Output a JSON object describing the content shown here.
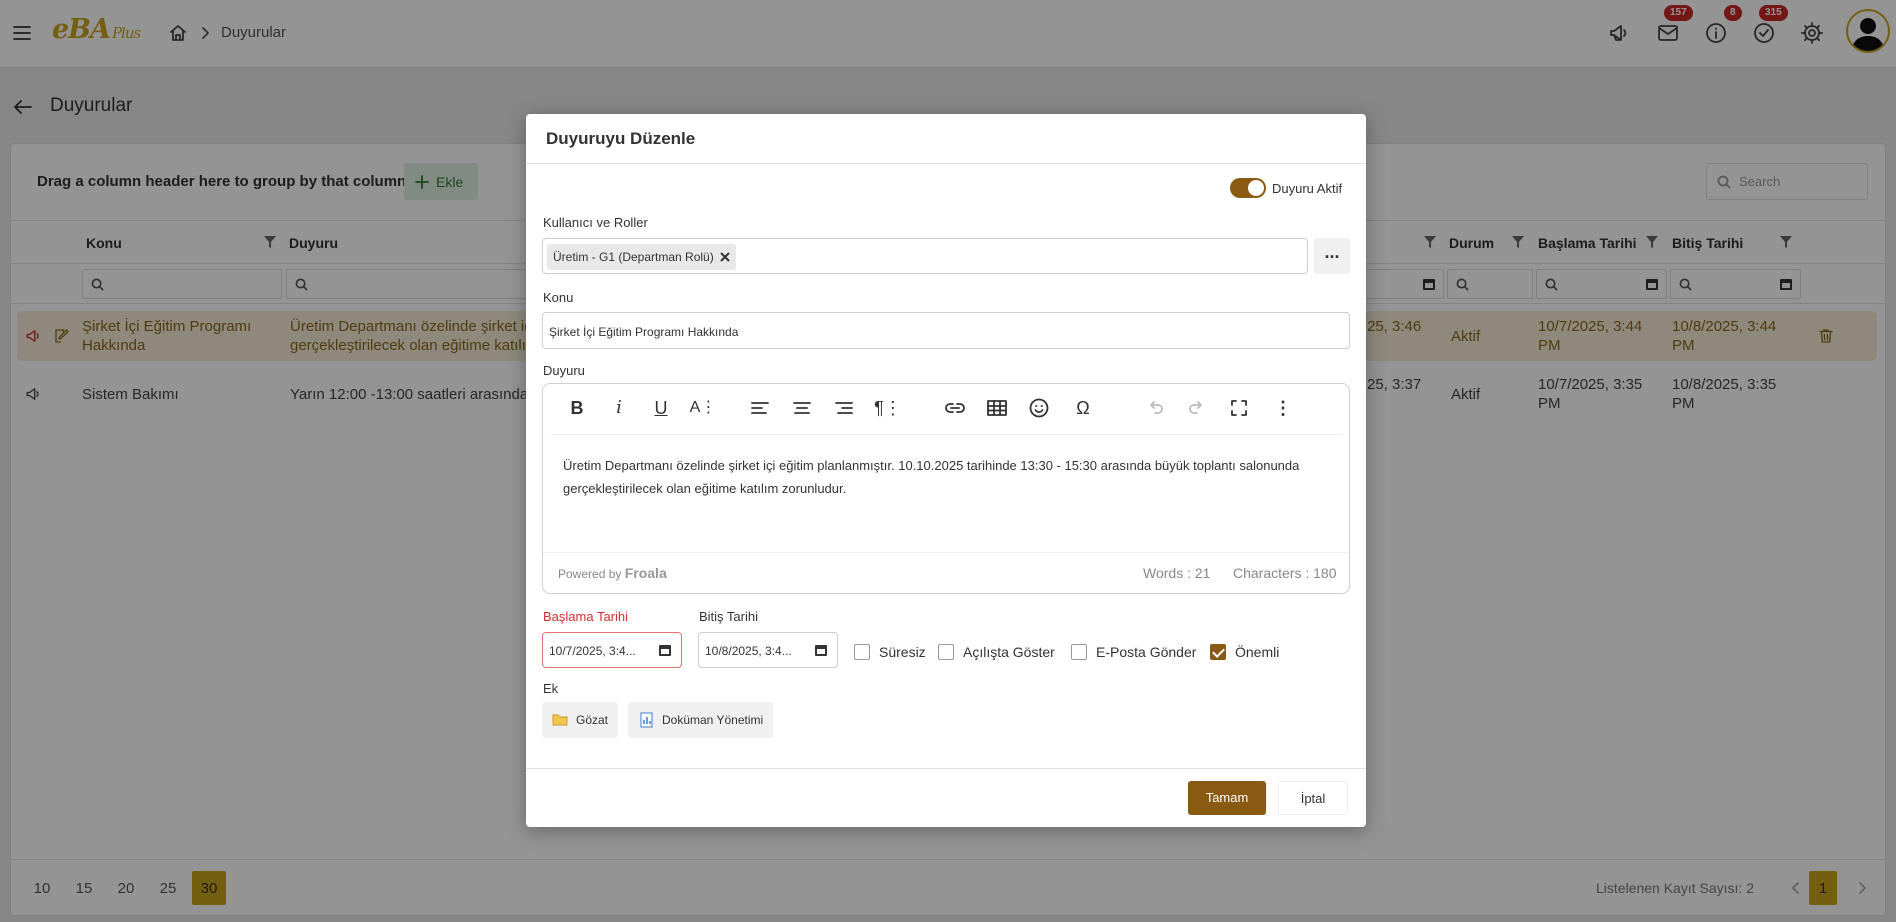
{
  "topbar": {
    "logo_main": "eBA",
    "logo_sub": "Plus",
    "breadcrumb": "Duyurular",
    "badges": {
      "mail": "157",
      "info": "8",
      "tasks": "315"
    }
  },
  "page": {
    "title": "Duyurular"
  },
  "grid": {
    "group_hint": "Drag a column header here to group by that column",
    "add_label": "Ekle",
    "search_placeholder": "Search",
    "columns": {
      "konu": "Konu",
      "duyuru": "Duyuru",
      "durum": "Durum",
      "baslama": "Başlama Tarihi",
      "bitis": "Bitiş Tarihi"
    },
    "rows": [
      {
        "konu": "Şirket İçi Eğitim Programı Hakkında",
        "duyuru": "Üretim Departmanı özelinde şirket iç gerçekleştirilecek olan eğitime katılı",
        "tarih": "25, 3:46",
        "durum": "Aktif",
        "baslama": "10/7/2025, 3:44 PM",
        "bitis": "10/8/2025, 3:44 PM"
      },
      {
        "konu": "Sistem Bakımı",
        "duyuru": "Yarın 12:00 -13:00 saatleri arasında",
        "tarih": "25, 3:37",
        "durum": "Aktif",
        "baslama": "10/7/2025, 3:35 PM",
        "bitis": "10/8/2025, 3:35 PM"
      }
    ],
    "page_sizes": [
      "10",
      "15",
      "20",
      "25",
      "30"
    ],
    "active_page_size": "30",
    "record_count": "Listelenen Kayıt Sayısı: 2",
    "current_page": "1"
  },
  "modal": {
    "title": "Duyuruyu Düzenle",
    "active_toggle_label": "Duyuru Aktif",
    "active": true,
    "users_label": "Kullanıcı ve Roller",
    "user_chip": "Üretim - G1 (Departman Rolü)",
    "more_label": "...",
    "konu_label": "Konu",
    "konu_value": "Şirket İçi Eğitim Programı Hakkında",
    "duyuru_label": "Duyuru",
    "duyuru_text": "Üretim Departmanı özelinde şirket içi eğitim planlanmıştır. 10.10.2025 tarihinde 13:30 - 15:30 arasında büyük toplantı salonunda gerçekleştirilecek olan eğitime katılım zorunludur.",
    "powered_by": "Powered by",
    "froala": "Froala",
    "words": "Words : 21",
    "characters": "Characters : 180",
    "start_label": "Başlama Tarihi",
    "start_value": "10/7/2025, 3:4...",
    "end_label": "Bitiş Tarihi",
    "end_value": "10/8/2025, 3:4...",
    "checkboxes": [
      {
        "label": "Süresiz",
        "checked": false
      },
      {
        "label": "Açılışta Göster",
        "checked": false
      },
      {
        "label": "E-Posta Gönder",
        "checked": false
      },
      {
        "label": "Önemli",
        "checked": true
      }
    ],
    "attach_label": "Ek",
    "browse_label": "Gözat",
    "doc_label": "Doküman Yönetimi",
    "ok_label": "Tamam",
    "cancel_label": "İptal"
  },
  "colors": {
    "accent": "#8a5a12",
    "logo": "#c8a21c",
    "badge": "#c62828"
  }
}
